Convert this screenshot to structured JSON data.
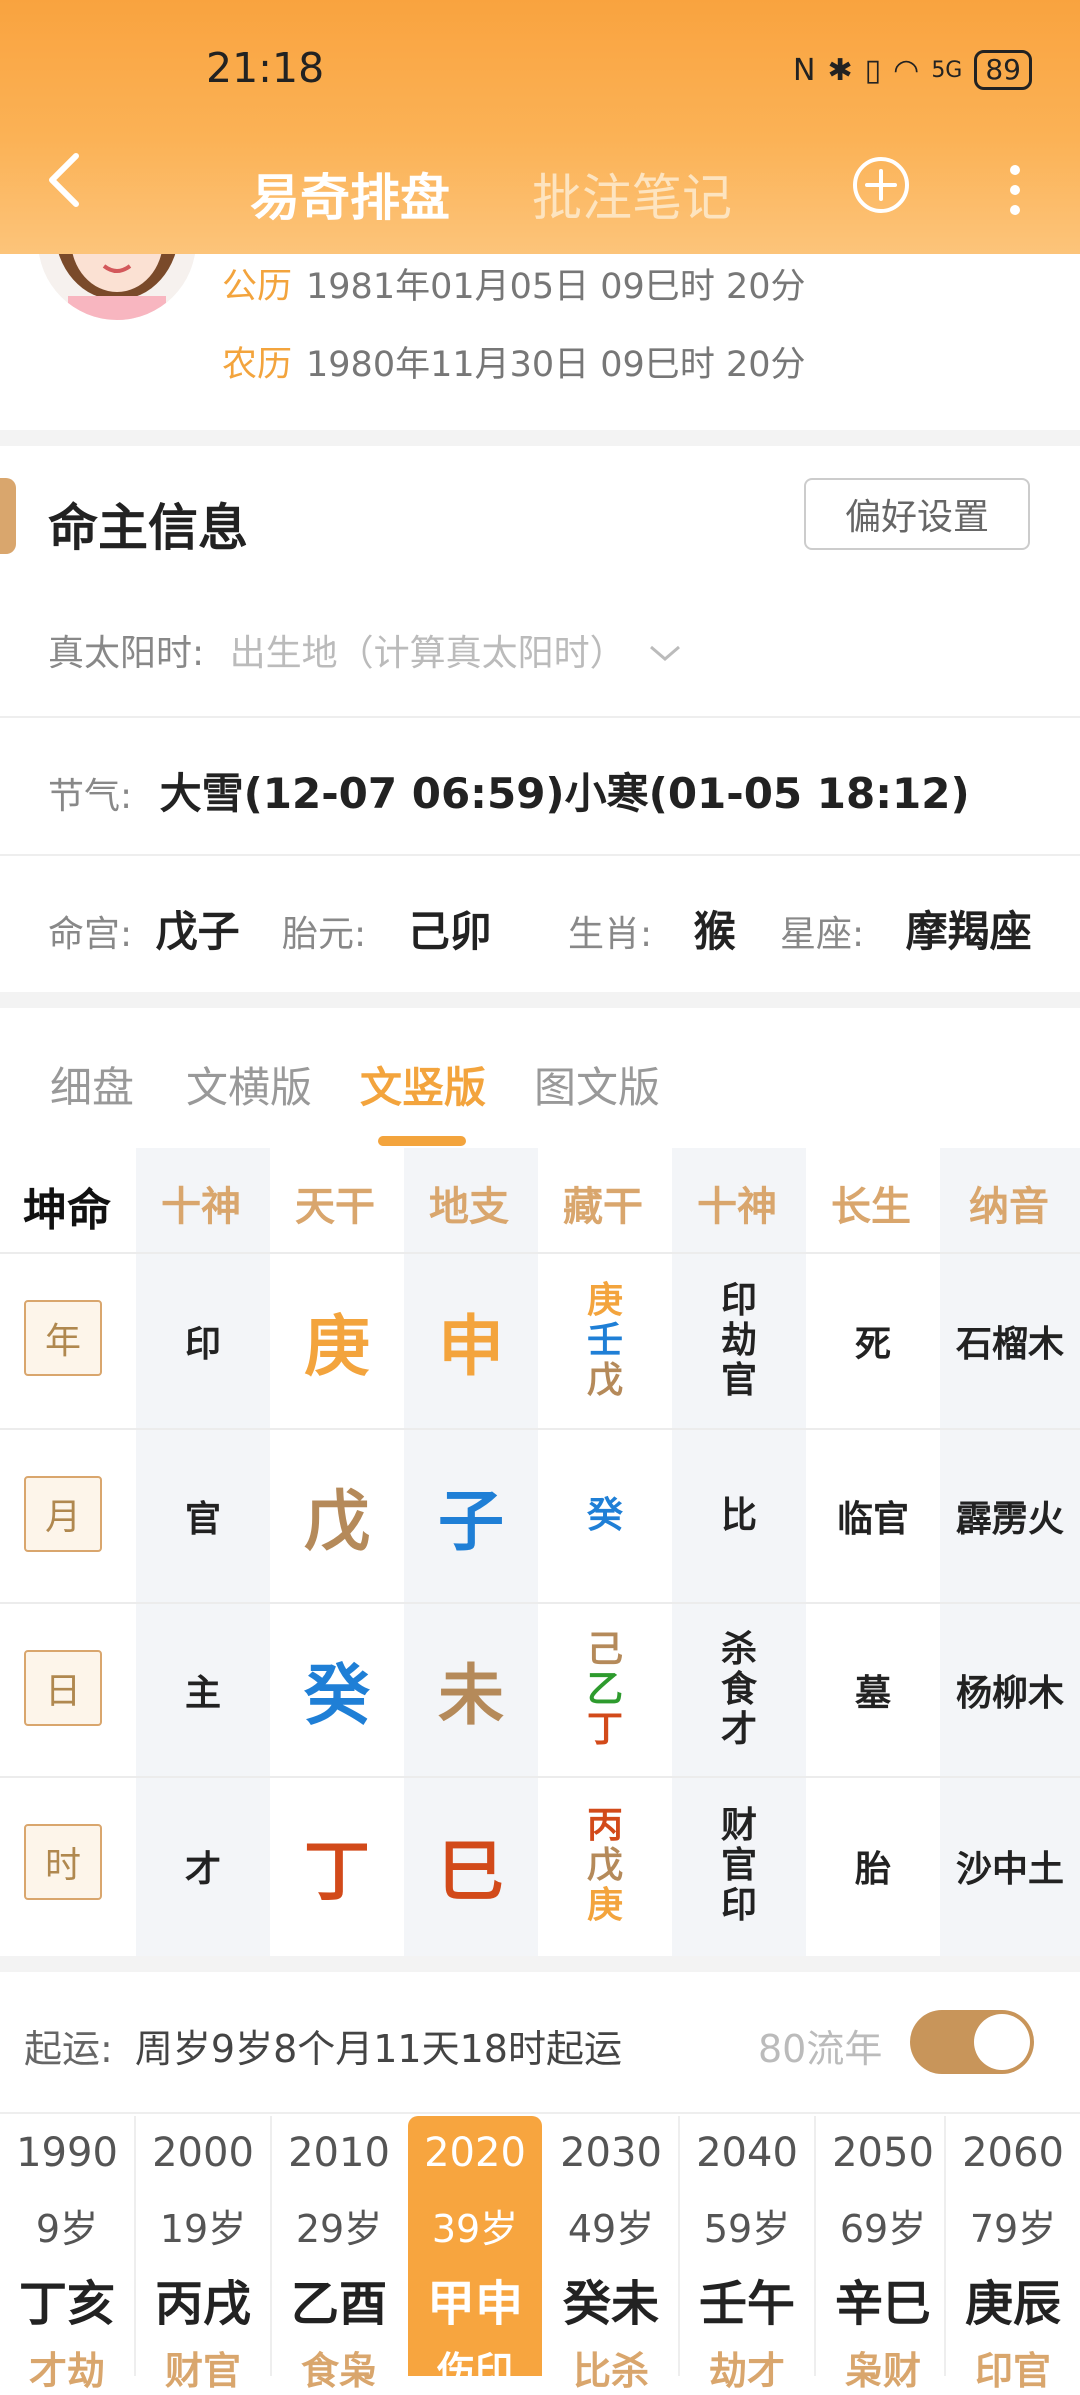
{
  "status": {
    "time": "21:18",
    "battery": "89",
    "network": "5G"
  },
  "nav": {
    "active_tab": "易奇排盘",
    "other_tab": "批注笔记"
  },
  "calendar": {
    "solar_label": "公历",
    "solar_value": "1981年01月05日 09巳时 20分",
    "lunar_label": "农历",
    "lunar_value": "1980年11月30日 09巳时 20分"
  },
  "section": {
    "title": "命主信息",
    "pref_button": "偏好设置"
  },
  "info": {
    "true_solar_label": "真太阳时:",
    "true_solar_placeholder": "出生地（计算真太阳时）",
    "jieqi_label": "节气:",
    "jieqi_value": "大雪(12-07 06:59)小寒(01-05 18:12)",
    "minggong_label": "命宫:",
    "minggong_value": "戊子",
    "taiyuan_label": "胎元:",
    "taiyuan_value": "己卯",
    "shengxiao_label": "生肖:",
    "shengxiao_value": "猴",
    "xingzuo_label": "星座:",
    "xingzuo_value": "摩羯座"
  },
  "tabs": [
    "细盘",
    "文横版",
    "文竖版",
    "图文版"
  ],
  "grid": {
    "corner": "坤命",
    "headers": [
      "十神",
      "天干",
      "地支",
      "藏干",
      "十神",
      "长生",
      "纳音"
    ],
    "rows": [
      {
        "tag": "年",
        "shishen": "印",
        "tiangan": "庚",
        "dizhi": "申",
        "canggan": [
          "庚",
          "壬",
          "戊"
        ],
        "shishen2": [
          "印",
          "劫",
          "官"
        ],
        "changsheng": "死",
        "nayin": "石榴木"
      },
      {
        "tag": "月",
        "shishen": "官",
        "tiangan": "戊",
        "dizhi": "子",
        "canggan": [
          "癸"
        ],
        "shishen2": [
          "比"
        ],
        "changsheng": "临官",
        "nayin": "霹雳火"
      },
      {
        "tag": "日",
        "shishen": "主",
        "tiangan": "癸",
        "dizhi": "未",
        "canggan": [
          "己",
          "乙",
          "丁"
        ],
        "shishen2": [
          "杀",
          "食",
          "才"
        ],
        "changsheng": "墓",
        "nayin": "杨柳木"
      },
      {
        "tag": "时",
        "shishen": "才",
        "tiangan": "丁",
        "dizhi": "巳",
        "canggan": [
          "丙",
          "戊",
          "庚"
        ],
        "shishen2": [
          "财",
          "官",
          "印"
        ],
        "changsheng": "胎",
        "nayin": "沙中土"
      }
    ],
    "colors": {
      "metal": "#f3a43d",
      "water": "#1f7fd6",
      "earth": "#b58a5a",
      "fire": "#d24a1a",
      "wood": "#2e9b2e"
    }
  },
  "qiyun": {
    "label": "起运:",
    "value": "周岁9岁8个月11天18时起运",
    "liunian_label": "80流年",
    "toggle_on": true
  },
  "dayun": [
    {
      "year": "1990",
      "age": "9岁",
      "gz": "丁亥",
      "god": "才劫"
    },
    {
      "year": "2000",
      "age": "19岁",
      "gz": "丙戌",
      "god": "财官"
    },
    {
      "year": "2010",
      "age": "29岁",
      "gz": "乙酉",
      "god": "食枭"
    },
    {
      "year": "2020",
      "age": "39岁",
      "gz": "甲申",
      "god": "伤印"
    },
    {
      "year": "2030",
      "age": "49岁",
      "gz": "癸未",
      "god": "比杀"
    },
    {
      "year": "2040",
      "age": "59岁",
      "gz": "壬午",
      "god": "劫才"
    },
    {
      "year": "2050",
      "age": "69岁",
      "gz": "辛巳",
      "god": "枭财"
    },
    {
      "year": "2060",
      "age": "79岁",
      "gz": "庚辰",
      "god": "印官"
    }
  ]
}
